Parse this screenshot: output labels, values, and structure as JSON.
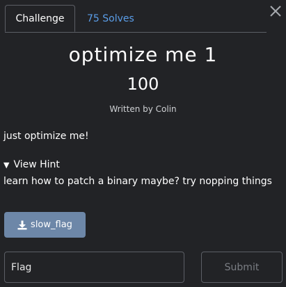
{
  "tabs": {
    "challenge_label": "Challenge",
    "solves_label": "75 Solves"
  },
  "challenge": {
    "name": "optimize me 1",
    "points": "100",
    "author": "Written by Colin",
    "description": "just optimize me!"
  },
  "hint": {
    "toggle_label": "View Hint",
    "text": "learn how to patch a binary maybe? try nopping things"
  },
  "files": [
    {
      "label": "slow_flag",
      "icon": "download-icon"
    }
  ],
  "flag_form": {
    "placeholder": "Flag",
    "submit_label": "Submit"
  },
  "colors": {
    "background": "#222326",
    "link": "#5b9ee9",
    "file_button": "#6d87a8",
    "border": "#5c5f66"
  }
}
